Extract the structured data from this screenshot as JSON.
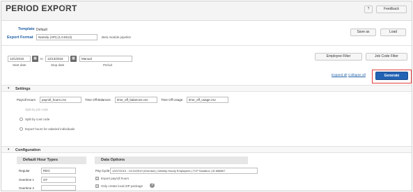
{
  "header": {
    "title": "PERIOD EXPORT",
    "help_label": "?",
    "feedback_label": "Feedback"
  },
  "template": {
    "label": "Template",
    "value": "Default"
  },
  "export_format": {
    "label": "Export Format",
    "value": "Namely (API) (1.0.8113)",
    "note": "Beta module pipeline"
  },
  "toolbar": {
    "save_as_label": "Save as",
    "load_label": "Load"
  },
  "dates": {
    "start_value": "12/1/2018",
    "start_caption": "Start date",
    "to_label": "to",
    "stop_value": "12/13/2018",
    "stop_caption": "Stop date",
    "period_value": "Manual",
    "period_caption": "Period"
  },
  "filters": {
    "employee_label": "Employee Filter",
    "job_code_label": "Job Code Filter"
  },
  "links": {
    "expand_all": "Expand all",
    "collapse_all": "Collapse all"
  },
  "generate_label": "Generate",
  "settings": {
    "title": "Settings",
    "payroll_hours_label": "Payroll Hours",
    "payroll_hours_value": "payroll_hours.csv",
    "time_off_balances_label": "Time Off Balances",
    "time_off_balances_value": "time_off_balances.csv",
    "time_off_usage_label": "Time Off Usage",
    "time_off_usage_value": "time_off_usage.csv",
    "split_job_code": "Split by job code",
    "split_cost_code": "Split by cost code",
    "export_salaried": "Export hours for salaried individuals"
  },
  "configuration": {
    "title": "Configuration",
    "default_hour_types_title": "Default Hour Types",
    "regular_label": "Regular",
    "regular_value": "REG",
    "overtime1_label": "Overtime 1",
    "overtime1_value": "OT",
    "overtime2_label": "Overtime 2",
    "overtime2_value": "",
    "data_options_title": "Data Options",
    "pay_cycle_label": "Pay Cycle",
    "pay_cycle_value": "12/07/2019 - 12/13/2019 (Overdue) | Weekly Hourly Employees | TCP Sandbox | ID 888807",
    "export_payroll_hours": "Export payroll hours",
    "only_create_zip": "Only create local ZIP package",
    "help_icon_label": "?"
  },
  "colors": {
    "accent": "#2463b4",
    "link": "#1f5fa6",
    "highlight": "#e23b3b"
  },
  "icons": {
    "star": "star-outline-icon",
    "calendar": "calendar-icon",
    "caret": "caret-down-icon",
    "help": "help-circle-icon"
  }
}
